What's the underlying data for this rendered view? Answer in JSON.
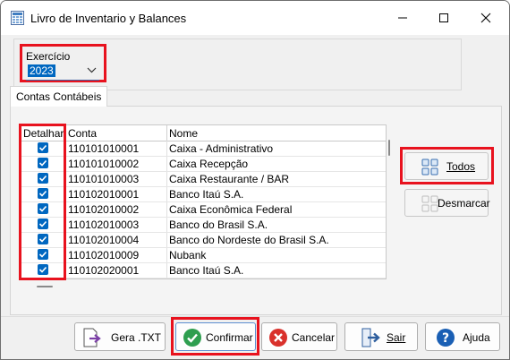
{
  "window": {
    "title": "Livro de Inventario y Balances"
  },
  "exercicio": {
    "label": "Exercício",
    "value": "2023"
  },
  "tab": {
    "label": "Contas Contábeis"
  },
  "grid": {
    "headers": {
      "detalhar": "Detalhar",
      "conta": "Conta",
      "nome": "Nome"
    },
    "rows": [
      {
        "conta": "110101010001",
        "nome": "Caixa - Administrativo",
        "checked": true
      },
      {
        "conta": "110101010002",
        "nome": "Caixa Recepção",
        "checked": true
      },
      {
        "conta": "110101010003",
        "nome": "Caixa Restaurante / BAR",
        "checked": true
      },
      {
        "conta": "110102010001",
        "nome": "Banco Itaú S.A.",
        "checked": true
      },
      {
        "conta": "110102010002",
        "nome": "Caixa Econômica Federal",
        "checked": true
      },
      {
        "conta": "110102010003",
        "nome": "Banco do Brasil S.A.",
        "checked": true
      },
      {
        "conta": "110102010004",
        "nome": "Banco do Nordeste do Brasil S.A.",
        "checked": true
      },
      {
        "conta": "110102010009",
        "nome": "Nubank",
        "checked": true
      },
      {
        "conta": "110102020001",
        "nome": "Banco Itaú S.A.",
        "checked": true
      }
    ]
  },
  "side_buttons": {
    "todos": "Todos",
    "desmarcar": "Desmarcar"
  },
  "bottom_buttons": {
    "gera_txt": "Gera .TXT",
    "confirmar": "Confirmar",
    "cancelar": "Cancelar",
    "sair": "Sair",
    "ajuda": "Ajuda"
  },
  "colors": {
    "highlight_red": "#e8121e",
    "accent_blue": "#0067c0",
    "confirm_green": "#2e9e4f",
    "cancel_red": "#d9302b",
    "help_blue": "#1a5fb4"
  }
}
